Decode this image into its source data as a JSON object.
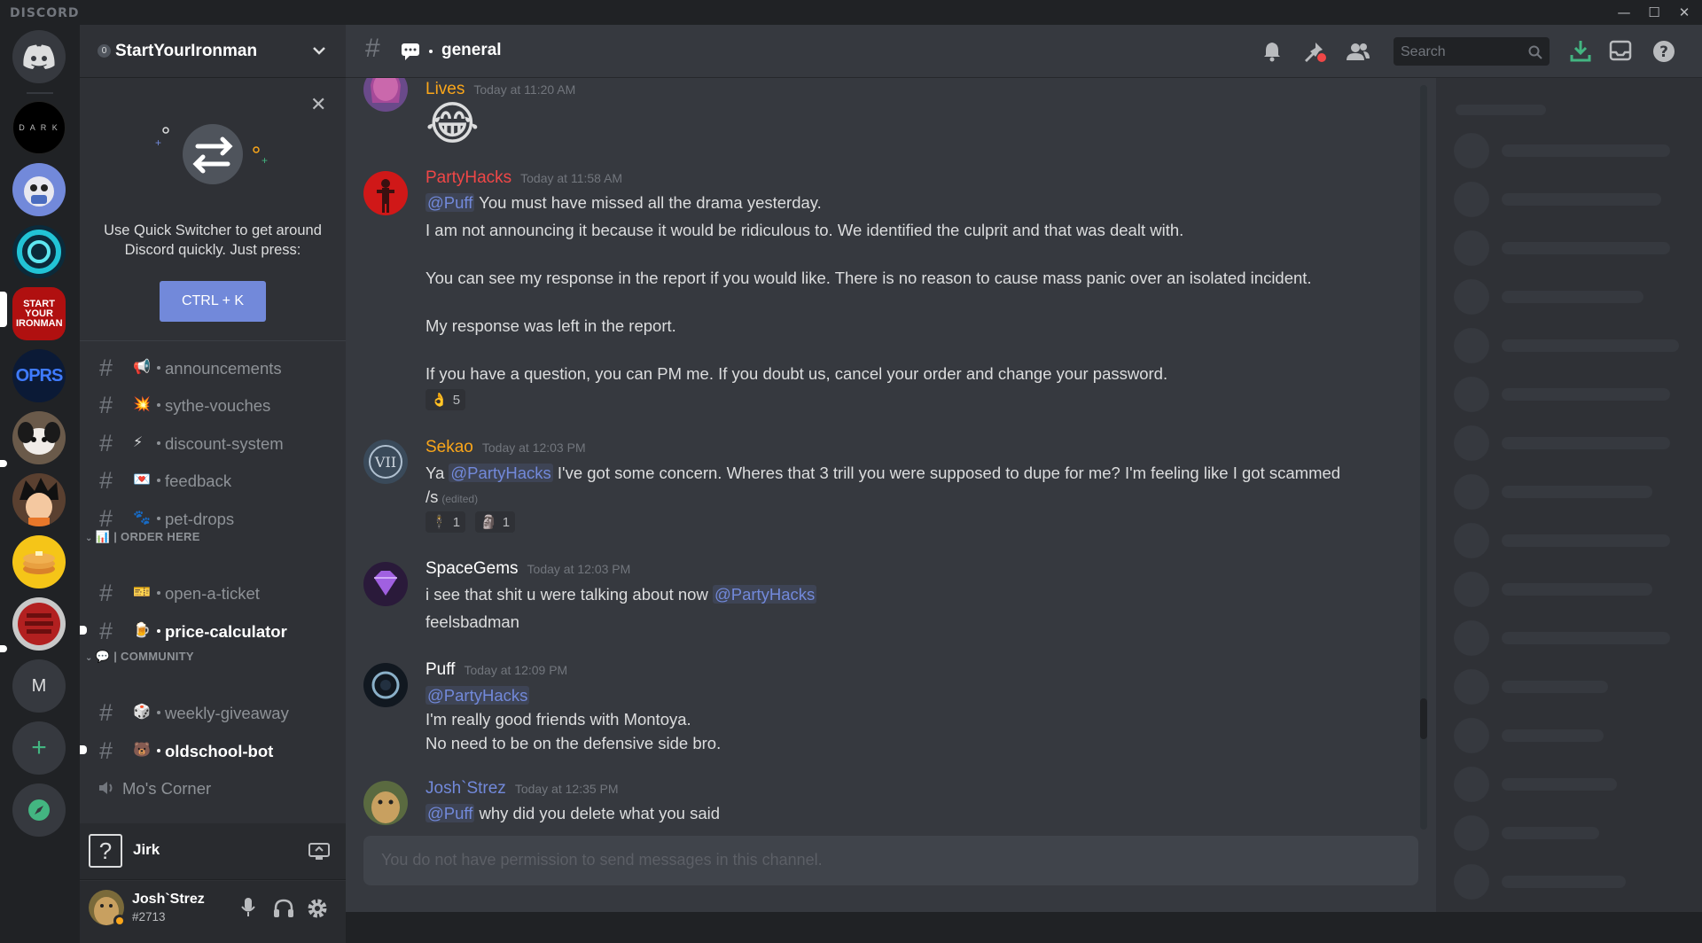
{
  "app": {
    "brand": "DISCORD",
    "window_controls": [
      "—",
      "☐",
      "✕"
    ]
  },
  "servers": [
    {
      "name": "Home",
      "initial": ""
    },
    {
      "name": "DARK",
      "initial": "D A R K"
    },
    {
      "name": "server-bot",
      "initial": ""
    },
    {
      "name": "server-swirl",
      "initial": ""
    },
    {
      "name": "StartYourIronman",
      "initial": "START YOUR IRONMAN"
    },
    {
      "name": "OPRS",
      "initial": "OPRS"
    },
    {
      "name": "server-puppy",
      "initial": ""
    },
    {
      "name": "server-anime",
      "initial": ""
    },
    {
      "name": "server-pancake",
      "initial": ""
    },
    {
      "name": "server-red",
      "initial": ""
    },
    {
      "name": "M",
      "initial": "M"
    }
  ],
  "guild": {
    "name": "StartYourIronman",
    "badge": "0"
  },
  "quick_switcher": {
    "text": "Use Quick Switcher to get around Discord quickly. Just press:",
    "button": "CTRL + K"
  },
  "channels": [
    {
      "name": "announcements",
      "emoji": "📢",
      "unread": false
    },
    {
      "name": "sythe-vouches",
      "emoji": "💥",
      "unread": false
    },
    {
      "name": "discount-system",
      "emoji": "⚡",
      "unread": false
    },
    {
      "name": "feedback",
      "emoji": "💌",
      "unread": false
    },
    {
      "name": "pet-drops",
      "emoji": "🐾",
      "unread": false
    }
  ],
  "category_order": {
    "label": "| ORDER HERE",
    "emoji": "📊"
  },
  "channels_order": [
    {
      "name": "open-a-ticket",
      "emoji": "🎫",
      "unread": false
    },
    {
      "name": "price-calculator",
      "emoji": "🍺",
      "unread": true
    }
  ],
  "category_community": {
    "label": "| COMMUNITY",
    "emoji": "💬"
  },
  "channels_community": [
    {
      "name": "weekly-giveaway",
      "emoji": "🎲",
      "unread": false
    },
    {
      "name": "oldschool-bot",
      "emoji": "🐻",
      "unread": true
    }
  ],
  "voice_channel": {
    "name": "Mo's Corner"
  },
  "voice_panel": {
    "name": "Jirk"
  },
  "user": {
    "name": "Josh`Strez",
    "tag": "#2713"
  },
  "channel_header": {
    "name": "general",
    "search_placeholder": "Search"
  },
  "messages": [
    {
      "author": "Lives",
      "color": "#faa61a",
      "time": "Today at 11:20 AM",
      "lines": [
        "😂"
      ]
    },
    {
      "author": "PartyHacks",
      "color": "#f04747",
      "time": "Today at 11:58 AM",
      "mention": "@Puff",
      "lines": [
        "You must have missed all the drama yesterday.",
        "I am not announcing it because it would be ridiculous to. We identified the culprit and that was dealt with.",
        "You can see my response in the report if you would like. There is no reason to cause mass panic over an isolated incident.",
        "My response was left in the report.",
        "If you have a question, you can PM me. If you doubt us, cancel your order and change your password."
      ],
      "reactions": [
        {
          "emoji": "👌",
          "count": "5"
        }
      ]
    },
    {
      "author": "Sekao",
      "color": "#faa61a",
      "time": "Today at 12:03 PM",
      "pre": "Ya",
      "mention": "@PartyHacks",
      "lines": [
        "I've got some concern. Wheres that 3 trill you were supposed to dupe for me? I'm feeling like I got scammed",
        "/s"
      ],
      "edited": "(edited)",
      "reactions": [
        {
          "emoji": "🕴",
          "count": "1"
        },
        {
          "emoji": "🗿",
          "count": "1"
        }
      ]
    },
    {
      "author": "SpaceGems",
      "color": "#ffffff",
      "time": "Today at 12:03 PM",
      "lines": [
        "i see that shit u were talking about now",
        "feelsbadman"
      ],
      "mention": "@PartyHacks"
    },
    {
      "author": "Puff",
      "color": "#ffffff",
      "time": "Today at 12:09 PM",
      "mention": "@PartyHacks",
      "lines": [
        "I'm really good friends with Montoya.",
        "No need to be on the defensive side bro."
      ]
    },
    {
      "author": "Josh`Strez",
      "color": "#7289da",
      "time": "Today at 12:35 PM",
      "mention": "@Puff",
      "lines": [
        "why did you delete what you said"
      ]
    }
  ],
  "composer": {
    "placeholder": "You do not have permission to send messages in this channel."
  },
  "colors": {
    "blurple": "#7289da",
    "red": "#f04747",
    "green": "#43b581",
    "orange": "#faa61a"
  }
}
